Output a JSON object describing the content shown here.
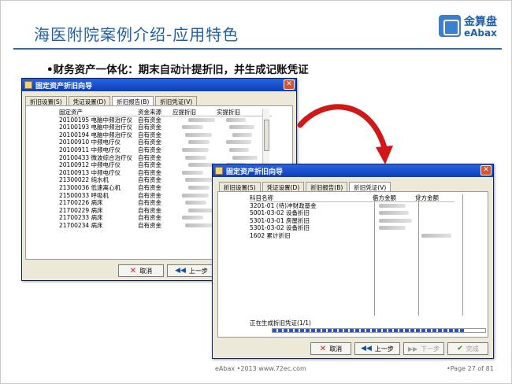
{
  "slide": {
    "title": "海医附院案例介绍-应用特色",
    "bullet": "•财务资产一体化：期末自动计提折旧，并生成记账凭证",
    "logo_cn": "金算盘",
    "logo_en": "eAbax",
    "footer_left": "eAbax  •2013  www.72ec.com",
    "footer_right": "•Page 27 of  81",
    "accent_color": "#1f5fa8"
  },
  "window1": {
    "title": "固定资产折旧向导",
    "tabs": [
      "折旧设置(S)",
      "凭证设置(D)",
      "折旧报告(B)",
      "折旧凭证(V)"
    ],
    "active_tab": 2,
    "columns": [
      "固定资产",
      "资金来源",
      "应提折旧",
      "实提折旧"
    ],
    "rows": [
      [
        "20100195 电脑中频治疗仪",
        "自有资金"
      ],
      [
        "20100193 电脑中频治疗仪",
        "自有资金"
      ],
      [
        "20100194 电脑中频治疗仪",
        "自有资金"
      ],
      [
        "20100910 中频电疗仪",
        "自有资金"
      ],
      [
        "20100911 中频电疗仪",
        "自有资金"
      ],
      [
        "20100433 微波综合治疗仪",
        "自有资金"
      ],
      [
        "20100912 中频电疗仪",
        "自有资金"
      ],
      [
        "20100913 中频电疗仪",
        "自有资金"
      ],
      [
        "21300022 纯水机",
        "自有资金"
      ],
      [
        "21300036 低速离心机",
        "自有资金"
      ],
      [
        "21500033 呼吸机",
        "自有资金"
      ],
      [
        "21700226 病床",
        "自有资金"
      ],
      [
        "21700229 病床",
        "自有资金"
      ],
      [
        "21700233 病床",
        "自有资金"
      ],
      [
        "21700234 病床",
        "自有资金"
      ]
    ],
    "cancel_label": "取消",
    "prev_label": "上一步"
  },
  "window2": {
    "title": "固定资产折旧向导",
    "tabs": [
      "折旧设置(S)",
      "凭证设置(D)",
      "折旧报告(B)",
      "折旧凭证(V)"
    ],
    "active_tab": 3,
    "columns": [
      "科目名称",
      "借方金额",
      "贷方金额"
    ],
    "rows": [
      "3201-01 (待)冲财政基金",
      "5001-03-02 设备折旧",
      "5301-03-01 房屋折旧",
      "5301-03-02 设备折旧",
      "1602 累计折旧"
    ],
    "progress_label": "正在生成折旧凭证(1/1)",
    "progress": 0.9,
    "cancel_label": "取消",
    "prev_label": "上一步",
    "next_label": "下一步",
    "finish_label": "完成"
  },
  "arrow_color": "#d01818"
}
